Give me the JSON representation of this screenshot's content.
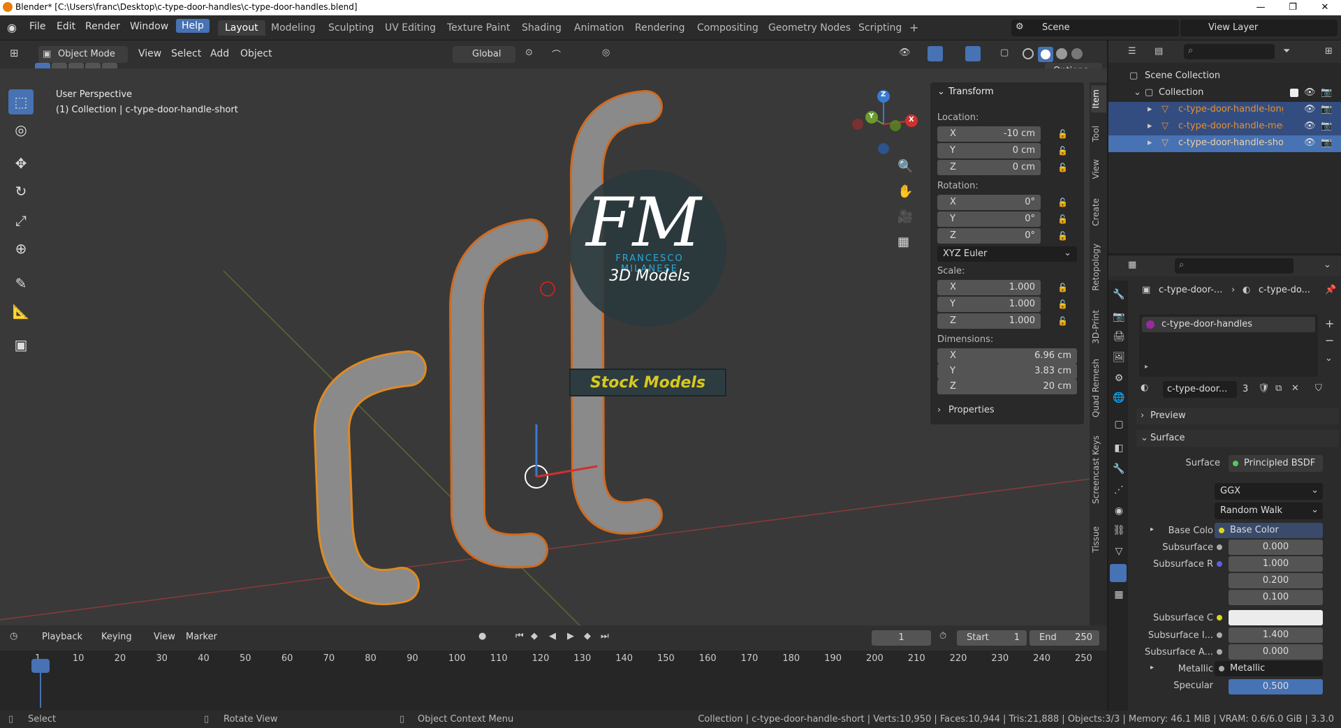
{
  "titlebar": {
    "title": "Blender* [C:\\Users\\franc\\Desktop\\c-type-door-handles\\c-type-door-handles.blend]"
  },
  "menus": [
    "File",
    "Edit",
    "Render",
    "Window",
    "Help"
  ],
  "workspaces": [
    "Layout",
    "Modeling",
    "Sculpting",
    "UV Editing",
    "Texture Paint",
    "Shading",
    "Animation",
    "Rendering",
    "Compositing",
    "Geometry Nodes",
    "Scripting"
  ],
  "scene": {
    "label": "Scene",
    "view_layer": "View Layer"
  },
  "header3d": {
    "mode": "Object Mode",
    "view": "View",
    "select": "Select",
    "add": "Add",
    "object": "Object",
    "orientation": "Global",
    "options": "Options"
  },
  "viewport": {
    "perspective": "User Perspective",
    "collection_info": "(1) Collection | c-type-door-handle-short",
    "watermark_initials": "FM",
    "watermark_name": "FRANCESCO MILANESE",
    "watermark_sub": "3D Models",
    "watermark_banner": "Stock Models"
  },
  "gizmo": {
    "z": "Z",
    "y": "Y",
    "x": "X"
  },
  "npanel": {
    "title": "Transform",
    "location_label": "Location:",
    "location": [
      {
        "ax": "X",
        "val": "-10 cm"
      },
      {
        "ax": "Y",
        "val": "0 cm"
      },
      {
        "ax": "Z",
        "val": "0 cm"
      }
    ],
    "rotation_label": "Rotation:",
    "rotation": [
      {
        "ax": "X",
        "val": "0°"
      },
      {
        "ax": "Y",
        "val": "0°"
      },
      {
        "ax": "Z",
        "val": "0°"
      }
    ],
    "rotation_mode": "XYZ Euler",
    "scale_label": "Scale:",
    "scale": [
      {
        "ax": "X",
        "val": "1.000"
      },
      {
        "ax": "Y",
        "val": "1.000"
      },
      {
        "ax": "Z",
        "val": "1.000"
      }
    ],
    "dimensions_label": "Dimensions:",
    "dimensions": [
      {
        "ax": "X",
        "val": "6.96 cm"
      },
      {
        "ax": "Y",
        "val": "3.83 cm"
      },
      {
        "ax": "Z",
        "val": "20 cm"
      }
    ],
    "properties": "Properties"
  },
  "vtabs": [
    "Item",
    "Tool",
    "View",
    "Create",
    "Retopology",
    "3D-Print",
    "Quad Remesh",
    "Screencast Keys",
    "Tissue"
  ],
  "outliner": {
    "scene_collection": "Scene Collection",
    "collection": "Collection",
    "items": [
      "c-type-door-handle-long",
      "c-type-door-handle-med",
      "c-type-door-handle-short"
    ]
  },
  "properties": {
    "breadcrumb1": "c-type-door-...",
    "breadcrumb2": "c-type-do...",
    "material_slot": "c-type-door-handles",
    "material_name": "c-type-door...",
    "material_users": "3",
    "preview": "Preview",
    "surface_section": "Surface",
    "surface_label": "Surface",
    "surface_value": "Principled BSDF",
    "distribution": "GGX",
    "subsurface_method": "Random Walk",
    "rows": [
      {
        "label": "Base Colo",
        "value": "Base Color"
      },
      {
        "label": "Subsurface",
        "value": "0.000"
      },
      {
        "label": "Subsurface R",
        "value": "1.000"
      },
      {
        "label": "",
        "value": "0.200"
      },
      {
        "label": "",
        "value": "0.100"
      },
      {
        "label": "Subsurface C",
        "value": ""
      },
      {
        "label": "Subsurface I...",
        "value": "1.400"
      },
      {
        "label": "Subsurface A...",
        "value": "0.000"
      },
      {
        "label": "Metallic",
        "value": "Metallic"
      },
      {
        "label": "Specular",
        "value": "0.500"
      }
    ]
  },
  "timeline": {
    "playback": "Playback",
    "keying": "Keying",
    "view": "View",
    "marker": "Marker",
    "current_frame": "1",
    "start_label": "Start",
    "start": "1",
    "end_label": "End",
    "end": "250",
    "ticks": [
      "1",
      "10",
      "20",
      "30",
      "40",
      "50",
      "60",
      "70",
      "80",
      "90",
      "100",
      "110",
      "120",
      "130",
      "140",
      "150",
      "160",
      "170",
      "180",
      "190",
      "200",
      "210",
      "220",
      "230",
      "240",
      "250"
    ]
  },
  "statusbar": {
    "select": "Select",
    "rotate": "Rotate View",
    "context": "Object Context Menu",
    "info": "Collection | c-type-door-handle-short | Verts:10,950 | Faces:10,944 | Tris:21,888 | Objects:3/3 | Memory: 46.1 MiB | VRAM: 0.6/6.0 GiB | 3.3.0"
  }
}
